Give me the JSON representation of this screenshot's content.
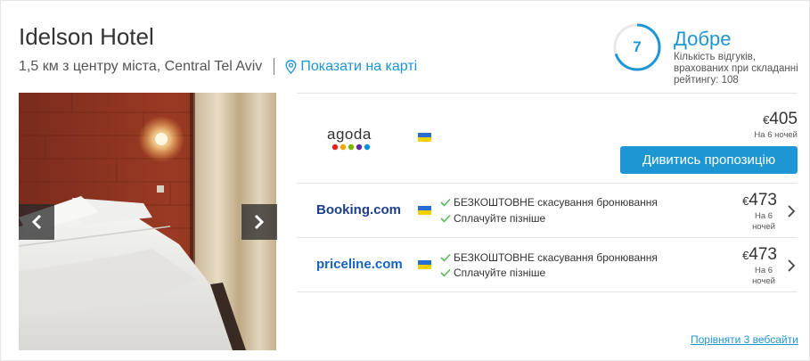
{
  "hotel": {
    "name": "Idelson Hotel",
    "distance": "1,5 км з центру міста, Central Tel Aviv",
    "map_link": "Показати на карті"
  },
  "rating": {
    "score": "7",
    "label": "Добре",
    "reviews_text": "Кількість відгуків, врахованих при складанні рейтингу: 108",
    "progress": 0.7
  },
  "offers": [
    {
      "provider": "agoda",
      "currency": "€",
      "price": "405",
      "nights": "На 6 ночей",
      "cta": "Дивитись пропозицію"
    },
    {
      "provider": "Booking.com",
      "features": [
        "БЕЗКОШТОВНЕ скасування бронювання",
        "Сплачуйте пізніше"
      ],
      "currency": "€",
      "price": "473",
      "nights_line1": "На 6",
      "nights_line2": "ночей"
    },
    {
      "provider": "priceline.com",
      "features": [
        "БЕЗКОШТОВНЕ скасування бронювання",
        "Сплачуйте пізніше"
      ],
      "currency": "€",
      "price": "473",
      "nights_line1": "На 6",
      "nights_line2": "ночей"
    }
  ],
  "compare_link": "Порівняти 3 вебсайти",
  "colors": {
    "accent": "#1e96d4",
    "check": "#5cb85c",
    "agoda_dots": [
      "#e1251b",
      "#f7a600",
      "#7ab800",
      "#5e2b97",
      "#0093d5"
    ]
  }
}
